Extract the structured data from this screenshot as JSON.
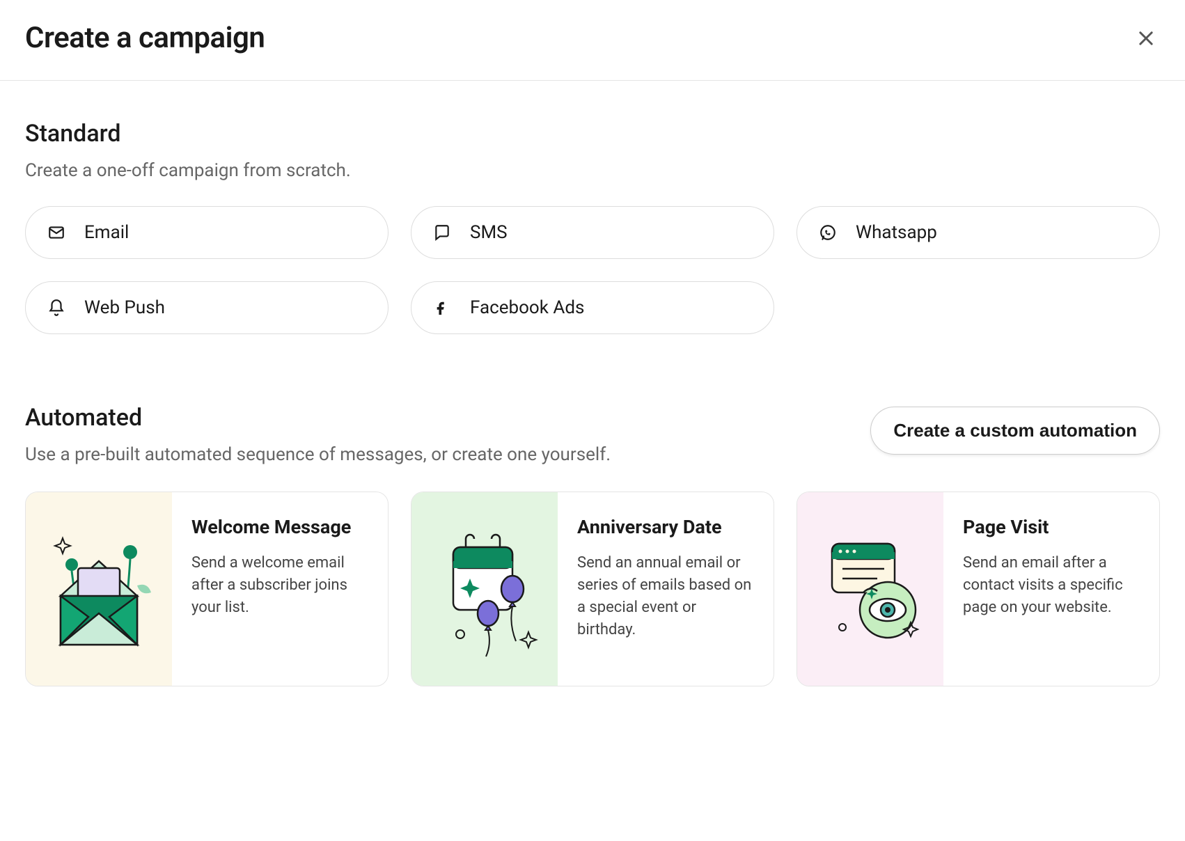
{
  "header": {
    "title": "Create a campaign"
  },
  "standard": {
    "title": "Standard",
    "subtitle": "Create a one-off campaign from scratch.",
    "options": {
      "email": "Email",
      "sms": "SMS",
      "whatsapp": "Whatsapp",
      "webpush": "Web Push",
      "facebook": "Facebook Ads"
    }
  },
  "automated": {
    "title": "Automated",
    "subtitle": "Use a pre-built automated sequence of messages, or create one yourself.",
    "custom_button": "Create a custom automation",
    "templates": {
      "welcome": {
        "title": "Welcome Message",
        "desc": "Send a welcome email after a subscriber joins your list."
      },
      "anniversary": {
        "title": "Anniversary Date",
        "desc": "Send an annual email or series of emails based on a special event or birthday."
      },
      "pagevisit": {
        "title": "Page Visit",
        "desc": "Send an email after a contact visits a specific page on your website."
      }
    }
  }
}
